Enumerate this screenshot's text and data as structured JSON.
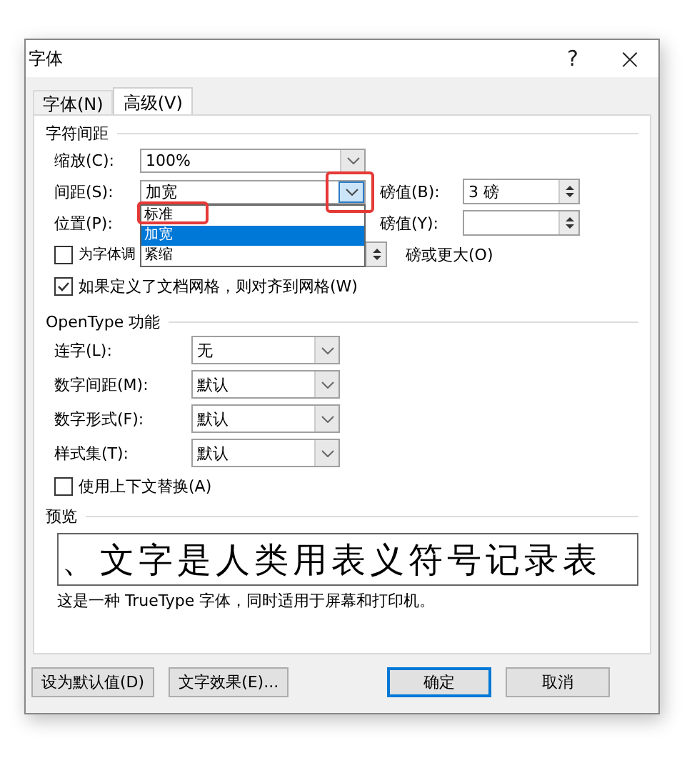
{
  "window": {
    "title": "字体",
    "help": "?",
    "close": "×"
  },
  "tabs": [
    {
      "label": "字体(N)",
      "selected": false
    },
    {
      "label": "高级(V)",
      "selected": true
    }
  ],
  "character_spacing": {
    "heading": "字符间距",
    "scale": {
      "label": "缩放(C):",
      "value": "100%"
    },
    "spacing": {
      "label": "间距(S):",
      "value": "加宽",
      "expanded": true,
      "options": [
        {
          "label": "标准",
          "selected": false
        },
        {
          "label": "加宽",
          "selected": true
        },
        {
          "label": "紧缩",
          "selected": false
        }
      ],
      "by_label": "磅值(B):",
      "by_value": "3 磅"
    },
    "position": {
      "label": "位置(P):",
      "by_label": "磅值(Y):"
    },
    "kerning": {
      "label": "为字体调",
      "checked": false,
      "suffix": "磅或更大(O)"
    },
    "snap_to_grid": {
      "label": "如果定义了文档网格，则对齐到网格(W)",
      "checked": true
    }
  },
  "opentype": {
    "heading": "OpenType 功能",
    "rows": [
      {
        "label": "连字(L):",
        "value": "无"
      },
      {
        "label": "数字间距(M):",
        "value": "默认"
      },
      {
        "label": "数字形式(F):",
        "value": "默认"
      },
      {
        "label": "样式集(T):",
        "value": "默认"
      }
    ],
    "contextual": {
      "label": "使用上下文替换(A)",
      "checked": false
    }
  },
  "preview": {
    "heading": "预览",
    "sample": "、文字是人类用表义符号记录表",
    "caption": "这是一种 TrueType 字体，同时适用于屏幕和打印机。"
  },
  "buttons": [
    {
      "label": "设为默认值(D)",
      "focused": false
    },
    {
      "label": "文字效果(E)...",
      "focused": false
    },
    {
      "label": "确定",
      "focused": true
    },
    {
      "label": "取消",
      "focused": false
    }
  ],
  "annotations": [
    {
      "kind": "highlight"
    },
    {
      "kind": "highlight"
    }
  ]
}
